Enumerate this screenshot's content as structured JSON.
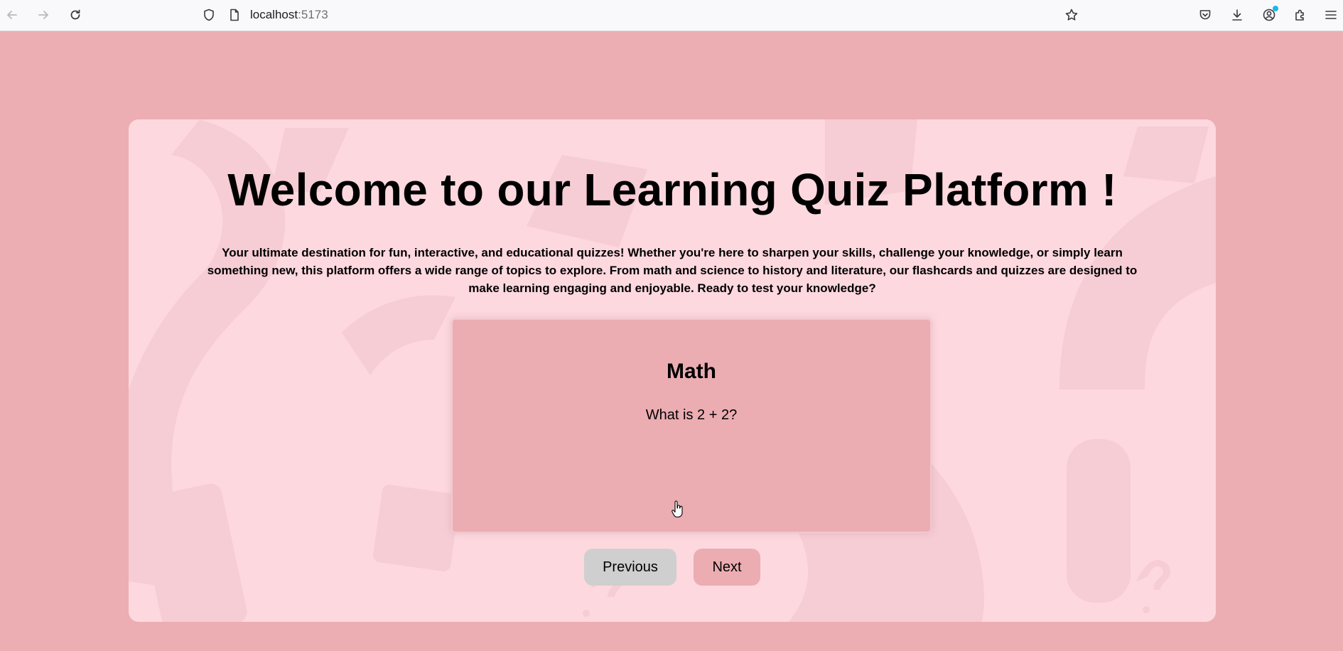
{
  "browser": {
    "url_host": "localhost",
    "url_port": ":5173",
    "icons": [
      "back-arrow-icon",
      "forward-arrow-icon",
      "reload-icon",
      "shield-icon",
      "page-icon",
      "star-icon",
      "pocket-icon",
      "download-icon",
      "account-icon",
      "extensions-icon",
      "menu-icon"
    ]
  },
  "page": {
    "title": "Welcome to our Learning Quiz Platform !",
    "intro": "Your ultimate destination for fun, interactive, and educational quizzes! Whether you're here to sharpen your skills, challenge your knowledge, or simply learn something new, this platform offers a wide range of topics to explore. From math and science to history and literature, our flashcards and quizzes are designed to make learning engaging and enjoyable. Ready to test your knowledge?"
  },
  "flashcard": {
    "subject": "Math",
    "question": "What is 2 + 2?"
  },
  "buttons": {
    "previous": "Previous",
    "next": "Next"
  },
  "colors": {
    "page_background": "#ecaeb3",
    "card_background": "#fdd8df",
    "flashcard_background": "#ebadb2",
    "previous_button": "#cfcfcf",
    "next_button": "#ebadb2"
  }
}
